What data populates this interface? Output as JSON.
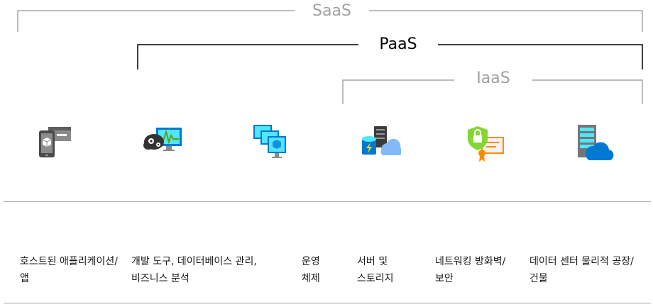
{
  "brackets": {
    "saas": "SaaS",
    "paas": "PaaS",
    "iaas": "IaaS"
  },
  "icons": [
    "hosted-app-icon",
    "dev-tools-icon",
    "database-management-icon",
    "operating-system-icon",
    "server-storage-icon",
    "network-firewall-icon",
    "datacenter-icon"
  ],
  "captions": {
    "hosted_apps": "호스트된 애플리케이션/앱",
    "dev_tools": "개발 도구, 데이터베이스 관리, 비즈니스 분석",
    "os": "운영 체제",
    "servers_storage": "서버 및 스토리지",
    "networking": "네트워킹 방화벽/보안",
    "datacenter": "데이터 센터 물리적 공장/건물"
  },
  "colors": {
    "bracket_gray": "#a6a6a6",
    "bracket_black": "#000000",
    "azure_blue": "#0078d4",
    "light_blue": "#50e6ff",
    "icon_gray": "#767676",
    "firewall_green": "#86d633",
    "certificate_orange": "#ff8c00"
  }
}
